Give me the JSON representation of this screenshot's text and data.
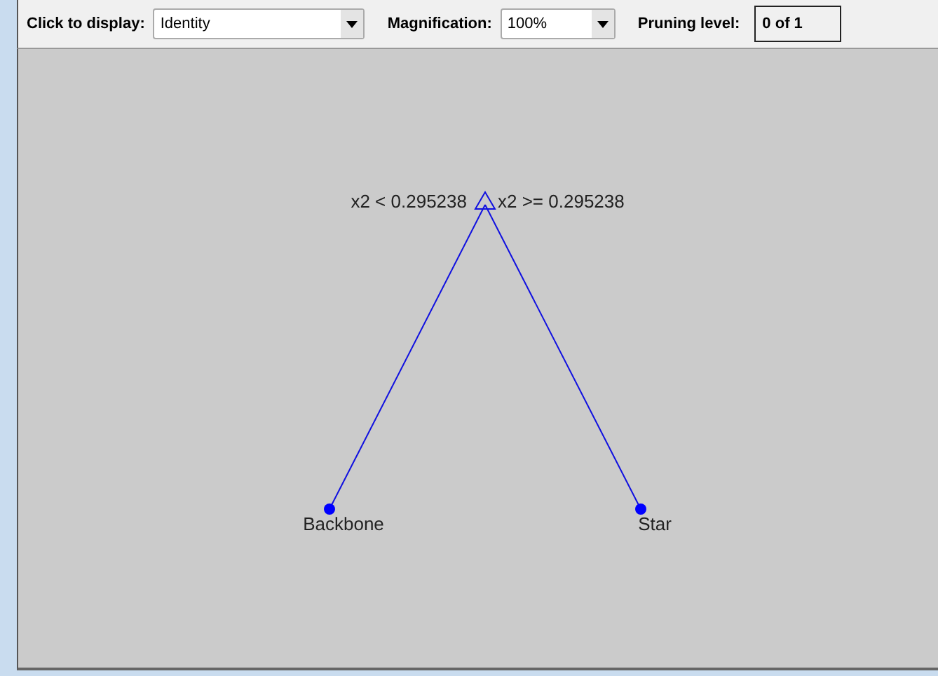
{
  "toolbar": {
    "display_label": "Click to display:",
    "display_value": "Identity",
    "magnification_label": "Magnification:",
    "magnification_value": "100%",
    "pruning_label": "Pruning level:",
    "pruning_value": "0 of 1"
  },
  "tree": {
    "kind": "branch",
    "rules": [
      "x2 < 0.295238",
      "x2 >= 0.295238"
    ],
    "children": [
      {
        "kind": "leaf",
        "label": "Backbone"
      },
      {
        "kind": "leaf",
        "label": "Star"
      }
    ]
  }
}
